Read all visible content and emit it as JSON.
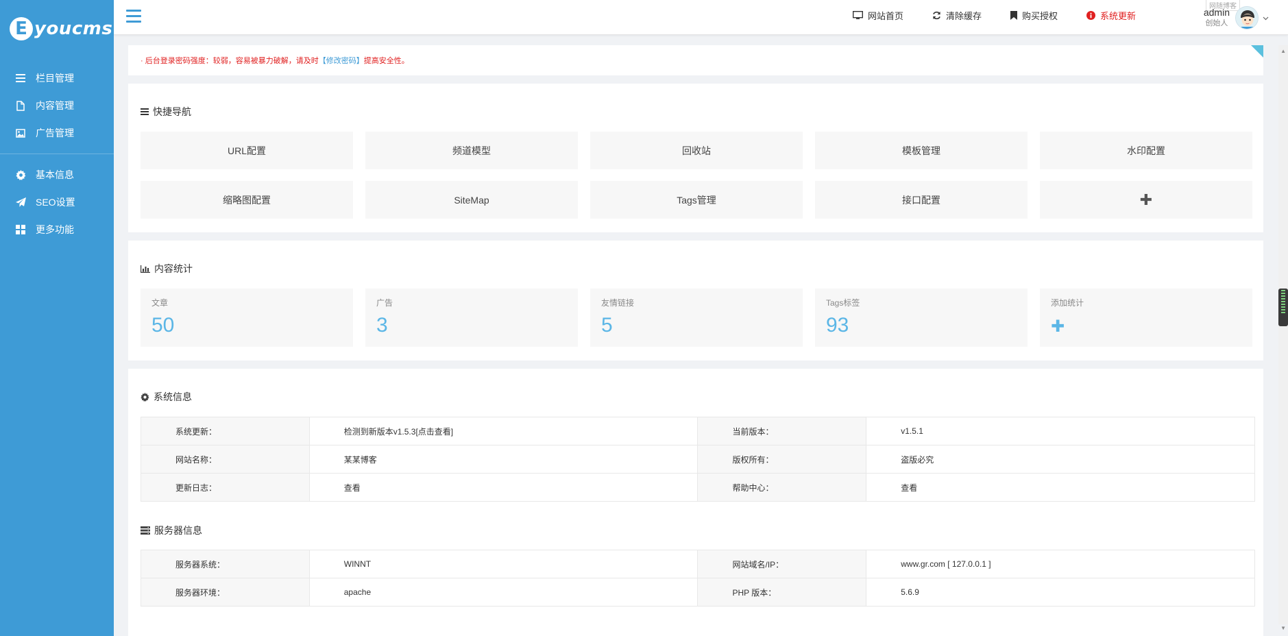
{
  "brand": {
    "logo_letter": "E",
    "logo_text": "youcms"
  },
  "sidebar": {
    "items": [
      {
        "label": "栏目管理",
        "icon": "list-icon"
      },
      {
        "label": "内容管理",
        "icon": "file-icon"
      },
      {
        "label": "广告管理",
        "icon": "image-icon"
      },
      {
        "label": "基本信息",
        "icon": "gear-icon"
      },
      {
        "label": "SEO设置",
        "icon": "paper-plane-icon"
      },
      {
        "label": "更多功能",
        "icon": "grid-icon"
      }
    ]
  },
  "topbar": {
    "links": [
      {
        "label": "网站首页",
        "icon": "monitor-icon"
      },
      {
        "label": "清除缓存",
        "icon": "refresh-icon"
      },
      {
        "label": "购买授权",
        "icon": "bookmark-icon"
      },
      {
        "label": "系统更新",
        "icon": "info-icon"
      }
    ],
    "tooltip": "网随博客",
    "user": {
      "name": "admin",
      "role": "创始人"
    }
  },
  "alert": {
    "prefix": "· 后台登录密码强度：较弱，容易被暴力破解，请及时",
    "link": "【修改密码】",
    "suffix": "提高安全性。"
  },
  "quick_nav": {
    "title": "快捷导航",
    "items": [
      "URL配置",
      "频道模型",
      "回收站",
      "模板管理",
      "水印配置",
      "缩略图配置",
      "SiteMap",
      "Tags管理",
      "接口配置",
      "✚"
    ]
  },
  "stats": {
    "title": "内容统计",
    "items": [
      {
        "label": "文章",
        "value": "50"
      },
      {
        "label": "广告",
        "value": "3"
      },
      {
        "label": "友情链接",
        "value": "5"
      },
      {
        "label": "Tags标签",
        "value": "93"
      },
      {
        "label": "添加统计",
        "value": "✚"
      }
    ]
  },
  "system_info": {
    "title": "系统信息",
    "rows": [
      {
        "k1": "系统更新：",
        "v1": "检测到新版本v1.5.3[点击查看]",
        "k2": "当前版本：",
        "v2": "v1.5.1"
      },
      {
        "k1": "网站名称：",
        "v1": "某某博客",
        "k2": "版权所有：",
        "v2": "盗版必究"
      },
      {
        "k1": "更新日志：",
        "v1": "查看",
        "k2": "帮助中心：",
        "v2": "查看"
      }
    ]
  },
  "server_info": {
    "title": "服务器信息",
    "rows": [
      {
        "k1": "服务器系统：",
        "v1": "WINNT",
        "k2": "网站域名/IP：",
        "v2": "www.gr.com [ 127.0.0.1 ]"
      },
      {
        "k1": "服务器环境：",
        "v1": "apache",
        "k2": "PHP 版本：",
        "v2": "5.6.9"
      }
    ]
  },
  "colors": {
    "sidebar": "#3e9bd6",
    "accent_red": "#e02020",
    "stat_value": "#5bb6e6"
  }
}
